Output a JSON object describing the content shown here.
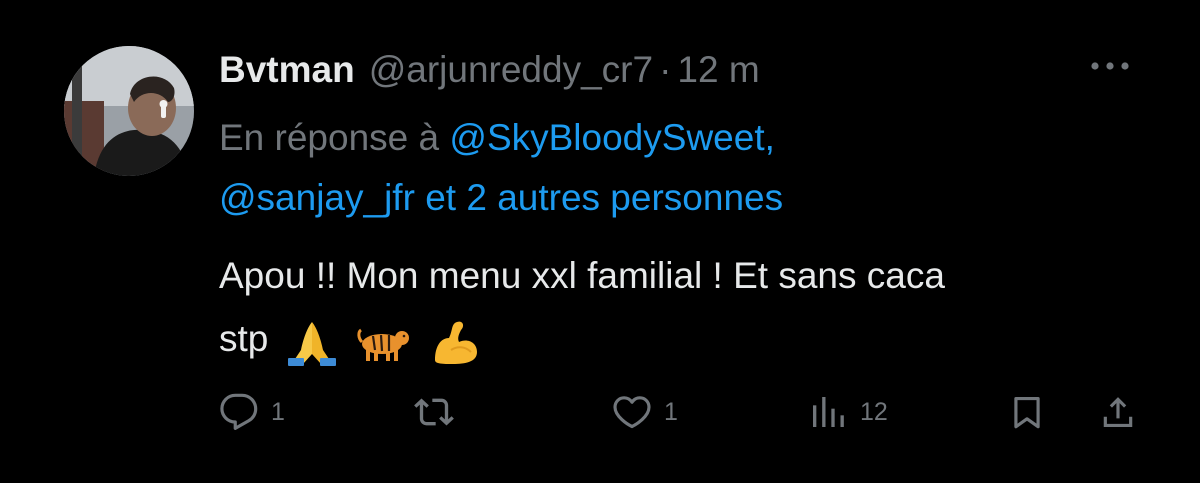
{
  "tweet": {
    "author": {
      "display_name": "Bvtman",
      "handle": "@arjunreddy_cr7",
      "separator": "·",
      "time": "12 m"
    },
    "reply_to": {
      "prefix": "En réponse à",
      "mention_1": "@SkyBloodySweet,",
      "mention_2": "@sanjay_jfr",
      "suffix": "et 2 autres personnes"
    },
    "text": {
      "line_1": "Apou !! Mon menu xxl familial ! Et sans caca",
      "line_2_prefix": "stp",
      "emojis": [
        "folded-hands-emoji",
        "tiger-emoji",
        "flexed-biceps-emoji"
      ]
    },
    "actions": {
      "reply_count": "1",
      "retweet_count": "",
      "like_count": "1",
      "views_count": "12"
    }
  },
  "colors": {
    "background": "#000000",
    "primary_text": "#e7e9ea",
    "secondary_text": "#71767b",
    "link": "#1d9bf0"
  }
}
